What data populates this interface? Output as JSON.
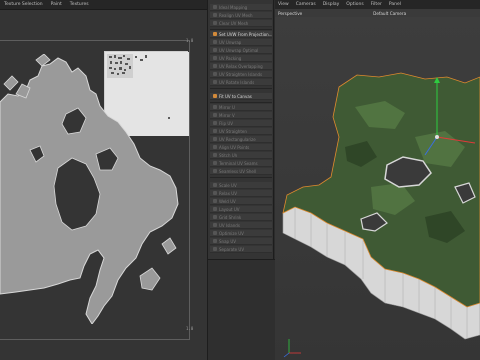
{
  "uv_editor": {
    "menu": [
      "Texture Selection",
      "Paint",
      "Textures"
    ],
    "corner_top_right": "1.0",
    "corner_bottom_left": "0.0",
    "corner_bottom_right": "1.0"
  },
  "commands": {
    "items": [
      {
        "label": "Ideal Mapping",
        "active": false
      },
      {
        "label": "Realign UV Mesh",
        "active": false
      },
      {
        "label": "Clear UV Mesh",
        "active": false
      },
      {
        "label": "Set UVW From Projection...",
        "active": true
      },
      {
        "label": "UV Unwrap",
        "active": false
      },
      {
        "label": "UV Unwrap Optimal",
        "active": false
      },
      {
        "label": "UV Packing",
        "active": false
      },
      {
        "label": "UV Relax Overlapping",
        "active": false
      },
      {
        "label": "UV Straighten Islands",
        "active": false
      },
      {
        "label": "UV Rotate Islands",
        "active": false
      },
      {
        "label": "Fit UV to Canvas",
        "active": true
      },
      {
        "label": "Mirror U",
        "active": false
      },
      {
        "label": "Mirror V",
        "active": false
      },
      {
        "label": "Flip UV",
        "active": false
      },
      {
        "label": "UV Straighten",
        "active": false
      },
      {
        "label": "UV Rectangularize",
        "active": false
      },
      {
        "label": "Align UV Points",
        "active": false
      },
      {
        "label": "Stitch UV",
        "active": false
      },
      {
        "label": "Terminal UV Seams",
        "active": false
      },
      {
        "label": "Seamless UV Shell",
        "active": false
      },
      {
        "label": "Scale UV",
        "active": false
      },
      {
        "label": "Relax UV",
        "active": false
      },
      {
        "label": "Weld UV",
        "active": false
      },
      {
        "label": "Layout UV",
        "active": false
      },
      {
        "label": "Grid Shrink",
        "active": false
      },
      {
        "label": "UV Islands",
        "active": false
      },
      {
        "label": "Optimize UV",
        "active": false
      },
      {
        "label": "Snap UV",
        "active": false
      },
      {
        "label": "Separate UV",
        "active": false
      }
    ]
  },
  "viewport": {
    "menu": [
      "View",
      "Cameras",
      "Display",
      "Options",
      "Filter",
      "Panel"
    ],
    "view_name": "Perspective",
    "camera": "Default Camera",
    "colors": {
      "terrain_top": "#3f5a34",
      "terrain_side": "#d9d9d9",
      "selection": "#e08a2e",
      "axis_y": "#2ecc40",
      "axis_x": "#e03a3a",
      "axis_z": "#3a6ee0"
    }
  }
}
